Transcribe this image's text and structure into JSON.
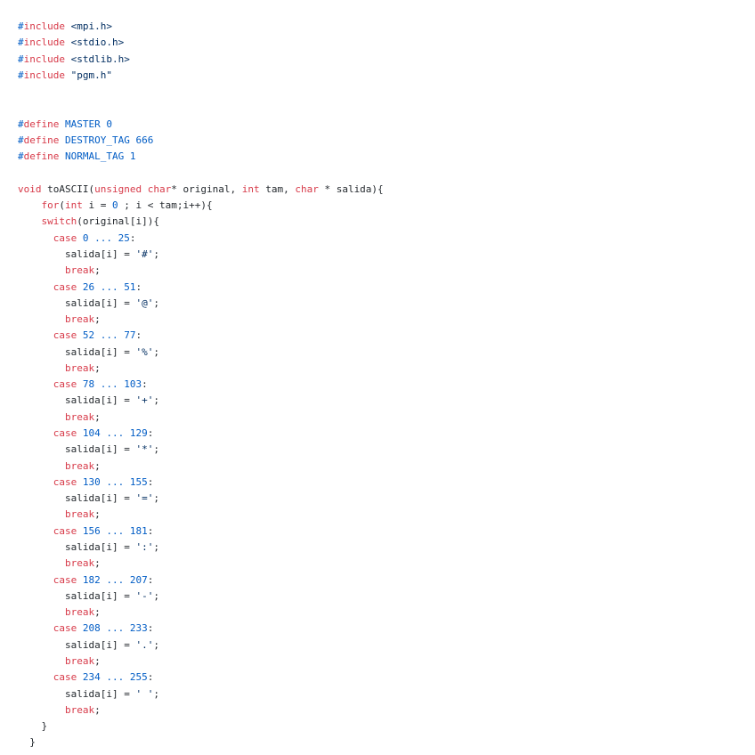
{
  "document": {
    "lines": [
      [
        {
          "t": "#",
          "c": "pre"
        },
        {
          "t": "include",
          "c": "kw"
        },
        {
          "t": " ",
          "c": "plain"
        },
        {
          "t": "<mpi.h>",
          "c": "str"
        }
      ],
      [
        {
          "t": "#",
          "c": "pre"
        },
        {
          "t": "include",
          "c": "kw"
        },
        {
          "t": " ",
          "c": "plain"
        },
        {
          "t": "<stdio.h>",
          "c": "str"
        }
      ],
      [
        {
          "t": "#",
          "c": "pre"
        },
        {
          "t": "include",
          "c": "kw"
        },
        {
          "t": " ",
          "c": "plain"
        },
        {
          "t": "<stdlib.h>",
          "c": "str"
        }
      ],
      [
        {
          "t": "#",
          "c": "pre"
        },
        {
          "t": "include",
          "c": "kw"
        },
        {
          "t": " ",
          "c": "plain"
        },
        {
          "t": "\"pgm.h\"",
          "c": "str"
        }
      ],
      [],
      [],
      [
        {
          "t": "#",
          "c": "pre"
        },
        {
          "t": "define",
          "c": "kw"
        },
        {
          "t": " ",
          "c": "plain"
        },
        {
          "t": "MASTER 0",
          "c": "name"
        }
      ],
      [
        {
          "t": "#",
          "c": "pre"
        },
        {
          "t": "define",
          "c": "kw"
        },
        {
          "t": " ",
          "c": "plain"
        },
        {
          "t": "DESTROY_TAG 666",
          "c": "name"
        }
      ],
      [
        {
          "t": "#",
          "c": "pre"
        },
        {
          "t": "define",
          "c": "kw"
        },
        {
          "t": " ",
          "c": "plain"
        },
        {
          "t": "NORMAL_TAG 1",
          "c": "name"
        }
      ],
      [],
      [
        {
          "t": "void",
          "c": "kw"
        },
        {
          "t": " toASCII(",
          "c": "plain"
        },
        {
          "t": "unsigned",
          "c": "kw"
        },
        {
          "t": " ",
          "c": "plain"
        },
        {
          "t": "char",
          "c": "kw"
        },
        {
          "t": "* original, ",
          "c": "plain"
        },
        {
          "t": "int",
          "c": "kw"
        },
        {
          "t": " tam, ",
          "c": "plain"
        },
        {
          "t": "char",
          "c": "kw"
        },
        {
          "t": " * salida){",
          "c": "plain"
        }
      ],
      [
        {
          "t": "    ",
          "c": "plain"
        },
        {
          "t": "for",
          "c": "kw"
        },
        {
          "t": "(",
          "c": "plain"
        },
        {
          "t": "int",
          "c": "kw"
        },
        {
          "t": " i = ",
          "c": "plain"
        },
        {
          "t": "0",
          "c": "num"
        },
        {
          "t": " ; i < tam;i++){",
          "c": "plain"
        }
      ],
      [
        {
          "t": "    ",
          "c": "plain"
        },
        {
          "t": "switch",
          "c": "kw"
        },
        {
          "t": "(original[i]){",
          "c": "plain"
        }
      ],
      [
        {
          "t": "      ",
          "c": "plain"
        },
        {
          "t": "case",
          "c": "kw"
        },
        {
          "t": " ",
          "c": "plain"
        },
        {
          "t": "0 ... 25",
          "c": "num"
        },
        {
          "t": ":",
          "c": "plain"
        }
      ],
      [
        {
          "t": "        salida[i] = ",
          "c": "plain"
        },
        {
          "t": "'#'",
          "c": "str"
        },
        {
          "t": ";",
          "c": "plain"
        }
      ],
      [
        {
          "t": "        ",
          "c": "plain"
        },
        {
          "t": "break",
          "c": "kw"
        },
        {
          "t": ";",
          "c": "plain"
        }
      ],
      [
        {
          "t": "      ",
          "c": "plain"
        },
        {
          "t": "case",
          "c": "kw"
        },
        {
          "t": " ",
          "c": "plain"
        },
        {
          "t": "26 ... 51",
          "c": "num"
        },
        {
          "t": ":",
          "c": "plain"
        }
      ],
      [
        {
          "t": "        salida[i] = ",
          "c": "plain"
        },
        {
          "t": "'@'",
          "c": "str"
        },
        {
          "t": ";",
          "c": "plain"
        }
      ],
      [
        {
          "t": "        ",
          "c": "plain"
        },
        {
          "t": "break",
          "c": "kw"
        },
        {
          "t": ";",
          "c": "plain"
        }
      ],
      [
        {
          "t": "      ",
          "c": "plain"
        },
        {
          "t": "case",
          "c": "kw"
        },
        {
          "t": " ",
          "c": "plain"
        },
        {
          "t": "52 ... 77",
          "c": "num"
        },
        {
          "t": ":",
          "c": "plain"
        }
      ],
      [
        {
          "t": "        salida[i] = ",
          "c": "plain"
        },
        {
          "t": "'%'",
          "c": "str"
        },
        {
          "t": ";",
          "c": "plain"
        }
      ],
      [
        {
          "t": "        ",
          "c": "plain"
        },
        {
          "t": "break",
          "c": "kw"
        },
        {
          "t": ";",
          "c": "plain"
        }
      ],
      [
        {
          "t": "      ",
          "c": "plain"
        },
        {
          "t": "case",
          "c": "kw"
        },
        {
          "t": " ",
          "c": "plain"
        },
        {
          "t": "78 ... 103",
          "c": "num"
        },
        {
          "t": ":",
          "c": "plain"
        }
      ],
      [
        {
          "t": "        salida[i] = ",
          "c": "plain"
        },
        {
          "t": "'+'",
          "c": "str"
        },
        {
          "t": ";",
          "c": "plain"
        }
      ],
      [
        {
          "t": "        ",
          "c": "plain"
        },
        {
          "t": "break",
          "c": "kw"
        },
        {
          "t": ";",
          "c": "plain"
        }
      ],
      [
        {
          "t": "      ",
          "c": "plain"
        },
        {
          "t": "case",
          "c": "kw"
        },
        {
          "t": " ",
          "c": "plain"
        },
        {
          "t": "104 ... 129",
          "c": "num"
        },
        {
          "t": ":",
          "c": "plain"
        }
      ],
      [
        {
          "t": "        salida[i] = ",
          "c": "plain"
        },
        {
          "t": "'*'",
          "c": "str"
        },
        {
          "t": ";",
          "c": "plain"
        }
      ],
      [
        {
          "t": "        ",
          "c": "plain"
        },
        {
          "t": "break",
          "c": "kw"
        },
        {
          "t": ";",
          "c": "plain"
        }
      ],
      [
        {
          "t": "      ",
          "c": "plain"
        },
        {
          "t": "case",
          "c": "kw"
        },
        {
          "t": " ",
          "c": "plain"
        },
        {
          "t": "130 ... 155",
          "c": "num"
        },
        {
          "t": ":",
          "c": "plain"
        }
      ],
      [
        {
          "t": "        salida[i] = ",
          "c": "plain"
        },
        {
          "t": "'='",
          "c": "str"
        },
        {
          "t": ";",
          "c": "plain"
        }
      ],
      [
        {
          "t": "        ",
          "c": "plain"
        },
        {
          "t": "break",
          "c": "kw"
        },
        {
          "t": ";",
          "c": "plain"
        }
      ],
      [
        {
          "t": "      ",
          "c": "plain"
        },
        {
          "t": "case",
          "c": "kw"
        },
        {
          "t": " ",
          "c": "plain"
        },
        {
          "t": "156 ... 181",
          "c": "num"
        },
        {
          "t": ":",
          "c": "plain"
        }
      ],
      [
        {
          "t": "        salida[i] = ",
          "c": "plain"
        },
        {
          "t": "':'",
          "c": "str"
        },
        {
          "t": ";",
          "c": "plain"
        }
      ],
      [
        {
          "t": "        ",
          "c": "plain"
        },
        {
          "t": "break",
          "c": "kw"
        },
        {
          "t": ";",
          "c": "plain"
        }
      ],
      [
        {
          "t": "      ",
          "c": "plain"
        },
        {
          "t": "case",
          "c": "kw"
        },
        {
          "t": " ",
          "c": "plain"
        },
        {
          "t": "182 ... 207",
          "c": "num"
        },
        {
          "t": ":",
          "c": "plain"
        }
      ],
      [
        {
          "t": "        salida[i] = ",
          "c": "plain"
        },
        {
          "t": "'-'",
          "c": "str"
        },
        {
          "t": ";",
          "c": "plain"
        }
      ],
      [
        {
          "t": "        ",
          "c": "plain"
        },
        {
          "t": "break",
          "c": "kw"
        },
        {
          "t": ";",
          "c": "plain"
        }
      ],
      [
        {
          "t": "      ",
          "c": "plain"
        },
        {
          "t": "case",
          "c": "kw"
        },
        {
          "t": " ",
          "c": "plain"
        },
        {
          "t": "208 ... 233",
          "c": "num"
        },
        {
          "t": ":",
          "c": "plain"
        }
      ],
      [
        {
          "t": "        salida[i] = ",
          "c": "plain"
        },
        {
          "t": "'.'",
          "c": "str"
        },
        {
          "t": ";",
          "c": "plain"
        }
      ],
      [
        {
          "t": "        ",
          "c": "plain"
        },
        {
          "t": "break",
          "c": "kw"
        },
        {
          "t": ";",
          "c": "plain"
        }
      ],
      [
        {
          "t": "      ",
          "c": "plain"
        },
        {
          "t": "case",
          "c": "kw"
        },
        {
          "t": " ",
          "c": "plain"
        },
        {
          "t": "234 ... 255",
          "c": "num"
        },
        {
          "t": ":",
          "c": "plain"
        }
      ],
      [
        {
          "t": "        salida[i] = ",
          "c": "plain"
        },
        {
          "t": "' '",
          "c": "str"
        },
        {
          "t": ";",
          "c": "plain"
        }
      ],
      [
        {
          "t": "        ",
          "c": "plain"
        },
        {
          "t": "break",
          "c": "kw"
        },
        {
          "t": ";",
          "c": "plain"
        }
      ],
      [
        {
          "t": "    }",
          "c": "plain"
        }
      ],
      [
        {
          "t": "  }",
          "c": "plain"
        }
      ]
    ]
  },
  "colors": {
    "background": "#ffffff",
    "plain": "#24292e",
    "keyword": "#d73a49",
    "number": "#005cc5",
    "string": "#032f62",
    "name": "#005cc5"
  }
}
